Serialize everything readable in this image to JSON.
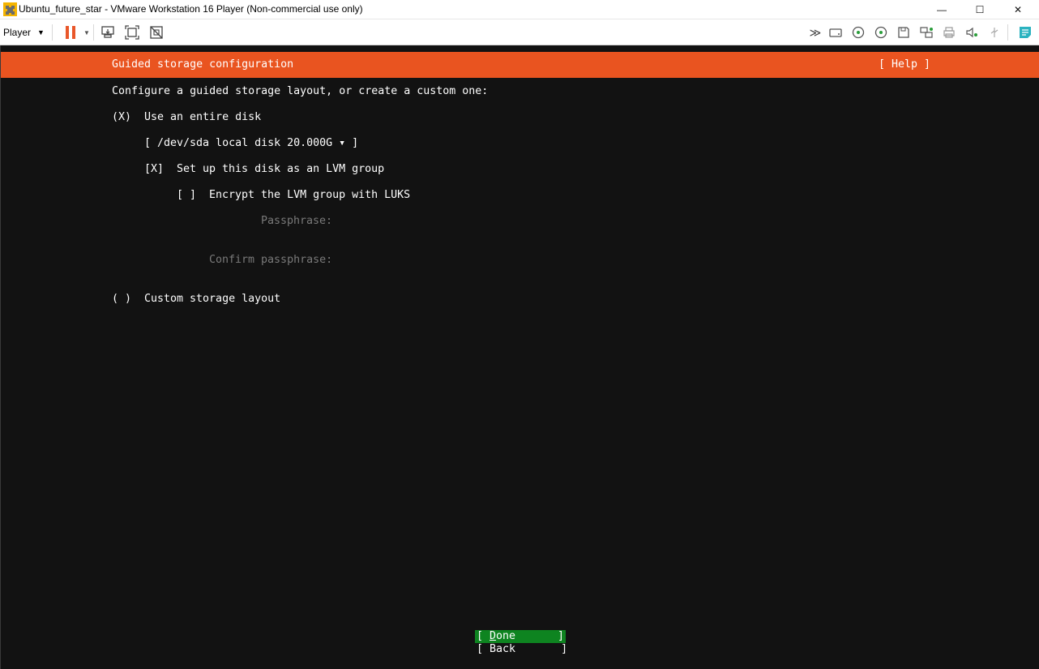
{
  "window": {
    "title": "Ubuntu_future_star - VMware Workstation 16 Player (Non-commercial use only)",
    "minimize_glyph": "—",
    "maximize_glyph": "☐",
    "close_glyph": "✕"
  },
  "toolbar": {
    "player_label": "Player",
    "icons": [
      "pause-icon",
      "send-ctrl-alt-del-icon",
      "full-screen-icon",
      "unity-icon",
      "more-devices-icon",
      "hard-disk-icon",
      "cd-dvd-icon",
      "cd-dvd-2-icon",
      "floppy-icon",
      "network-adapter-icon",
      "printer-icon",
      "sound-card-icon",
      "usb-icon",
      "message-log-icon"
    ]
  },
  "installer": {
    "header_title": "Guided storage configuration",
    "help_label": "[ Help ]",
    "prompt": "Configure a guided storage layout, or create a custom one:",
    "use_entire_disk_marker": "(X)",
    "use_entire_disk_label": "Use an entire disk",
    "disk_select": "[ /dev/sda local disk 20.000G ▾ ]",
    "lvm_marker": "[X]",
    "lvm_label": "Set up this disk as an LVM group",
    "encrypt_marker": "[ ]",
    "encrypt_label": "Encrypt the LVM group with LUKS",
    "passphrase_label": "Passphrase:",
    "confirm_passphrase_label": "Confirm passphrase:",
    "custom_marker": "( )",
    "custom_label": "Custom storage layout",
    "done_open": "[ ",
    "done_mnemonic": "D",
    "done_rest": "one",
    "done_close": "]",
    "back_label": "[ Back       ]"
  },
  "colors": {
    "header_bar": "#e95420",
    "done_button": "#0e8420",
    "console_bg": "#121212",
    "pause_accent": "#e9572a"
  }
}
